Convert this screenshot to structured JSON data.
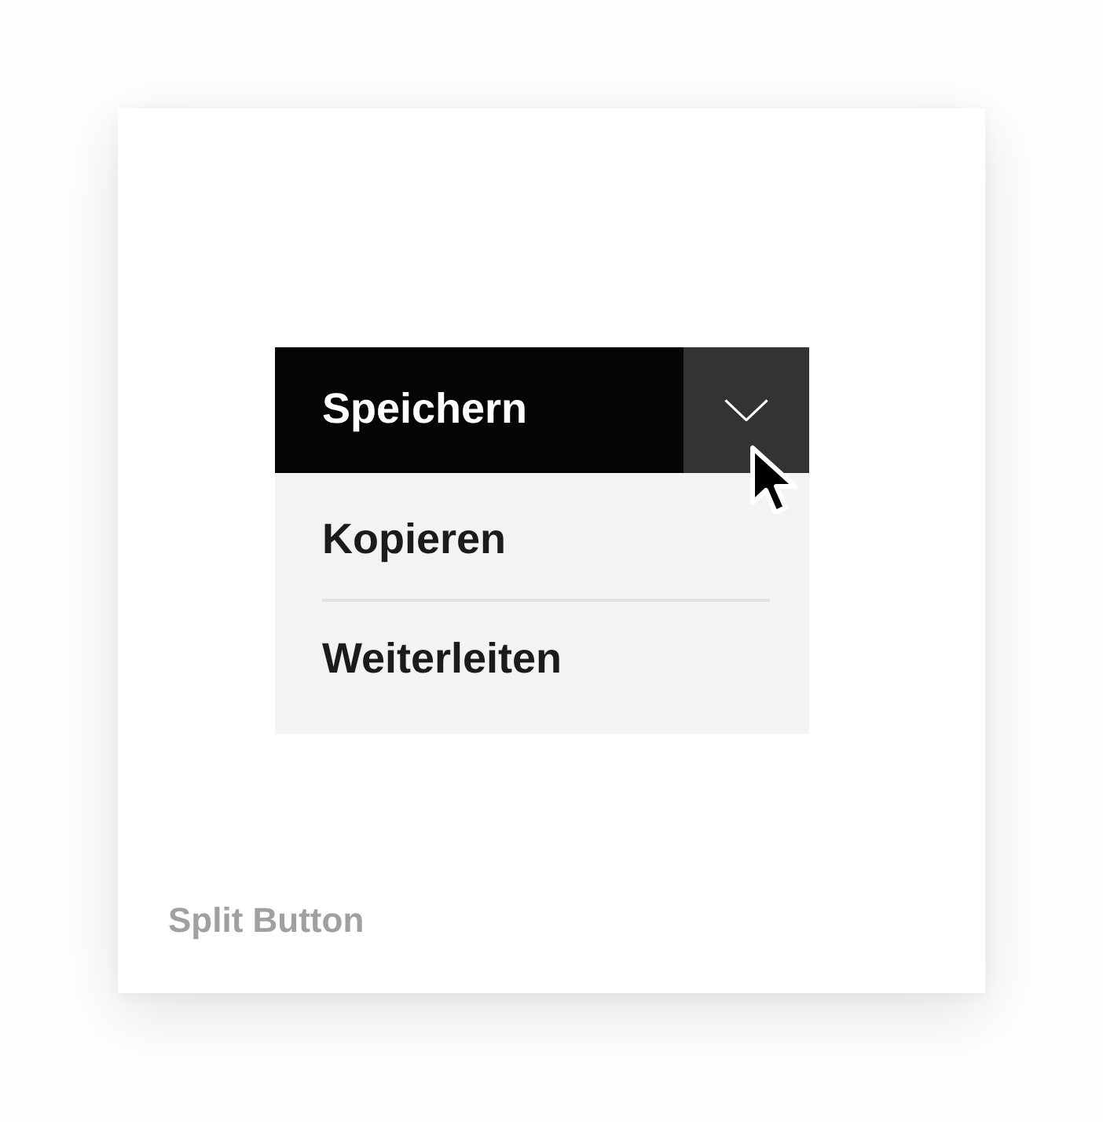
{
  "split_button": {
    "label": "Speichern",
    "expanded": true,
    "menu": [
      {
        "label": "Kopieren"
      },
      {
        "label": "Weiterleiten"
      }
    ]
  },
  "caption": "Split Button"
}
